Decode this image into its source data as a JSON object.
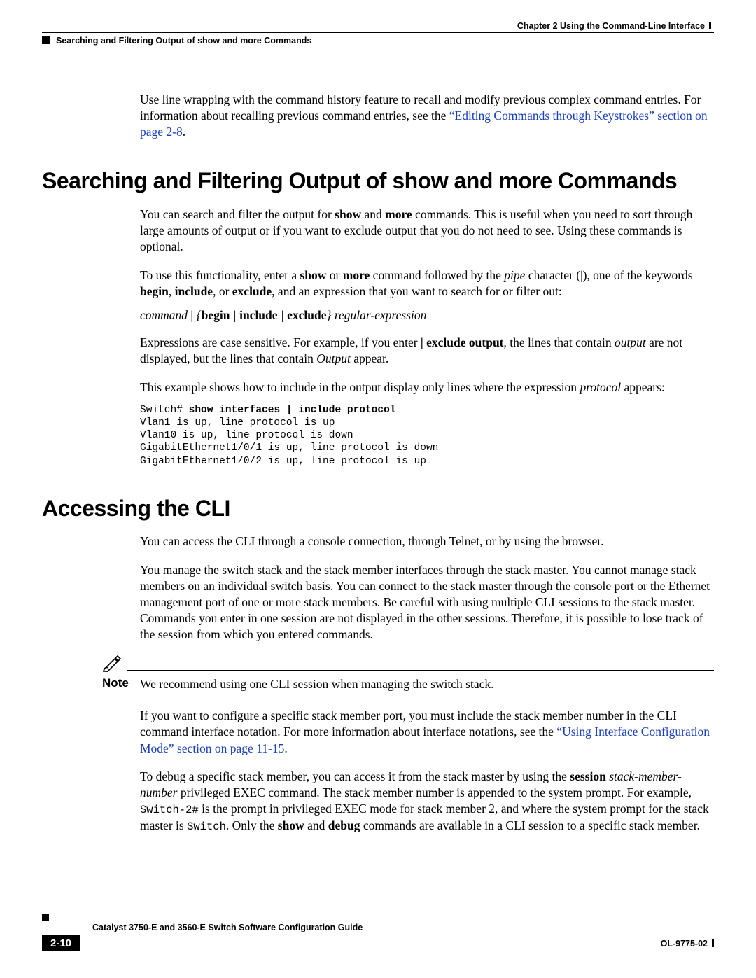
{
  "header": {
    "chapter": "Chapter 2      Using the Command-Line Interface",
    "section": "Searching and Filtering Output of show and more Commands"
  },
  "intro_para_pre": "Use line wrapping with the command history feature to recall and modify previous complex command entries. For information about recalling previous command entries, see the ",
  "intro_link": "“Editing Commands through Keystrokes” section on page 2-8",
  "intro_para_post": ".",
  "s1": {
    "title": "Searching and Filtering Output of show and more Commands",
    "p1_a": "You can search and filter the output for ",
    "p1_b": " and ",
    "p1_c": " commands. This is useful when you need to sort through large amounts of output or if you want to exclude output that you do not need to see. Using these commands is optional.",
    "p2_a": "To use this functionality, enter a ",
    "p2_b": " or ",
    "p2_c": " command followed by the ",
    "p2_d": " character (|), one of the keywords ",
    "p2_e": ", ",
    "p2_f": ", or ",
    "p2_g": ", and an expression that you want to search for or filter out:",
    "syntax_cmd": "command",
    "syntax_begin": "begin",
    "syntax_include": "include",
    "syntax_exclude": "exclude",
    "syntax_regex": "regular-expression",
    "p3_a": "Expressions are case sensitive. For example, if you enter ",
    "p3_b": ", the lines that contain ",
    "p3_c": " are not displayed, but the lines that contain ",
    "p3_d": " appear.",
    "p4_a": "This example shows how to include in the output display only lines where the expression ",
    "p4_b": " appears:",
    "code_prompt": "Switch# ",
    "code_cmd": "show interfaces | include protocol",
    "code_out": "Vlan1 is up, line protocol is up\nVlan10 is up, line protocol is down\nGigabitEthernet1/0/1 is up, line protocol is down\nGigabitEthernet1/0/2 is up, line protocol is up"
  },
  "s2": {
    "title": "Accessing the CLI",
    "p1": "You can access the CLI through a console connection, through Telnet, or by using the browser.",
    "p2": "You manage the switch stack and the stack member interfaces through the stack master. You cannot manage stack members on an individual switch basis. You can connect to the stack master through the console port or the Ethernet management port of one or more stack members. Be careful with using multiple CLI sessions to the stack master. Commands you enter in one session are not displayed in the other sessions. Therefore, it is possible to lose track of the session from which you entered commands.",
    "note_label": "Note",
    "note_text": "We recommend using one CLI session when managing the switch stack.",
    "p3_a": "If you want to configure a specific stack member port, you must include the stack member number in the CLI command interface notation. For more information about interface notations, see the ",
    "p3_link": "“Using Interface Configuration Mode” section on page 11-15",
    "p3_b": ".",
    "p4_a": "To debug a specific stack member, you can access it from the stack master by using the ",
    "p4_b": " ",
    "p4_c": " privileged EXEC command. The stack member number is appended to the system prompt. For example, ",
    "p4_d": " is the prompt in privileged EXEC mode for stack member 2, and where the system prompt for the stack master is ",
    "p4_e": ". Only the ",
    "p4_f": " and ",
    "p4_g": " commands are available in a CLI session to a specific stack member."
  },
  "bold_words": {
    "show": "show",
    "more": "more",
    "begin": "begin",
    "include": "include",
    "exclude": "exclude",
    "exclude_output": "| exclude output",
    "session": "session",
    "debug": "debug"
  },
  "italic_words": {
    "pipe": "pipe",
    "output": "output",
    "Output": "Output",
    "protocol": "protocol",
    "stack_member_number": "stack-member-number"
  },
  "mono_words": {
    "switch2": "Switch-2#",
    "switch": "Switch"
  },
  "footer": {
    "guide": "Catalyst 3750-E and 3560-E Switch Software Configuration Guide",
    "page": "2-10",
    "doc": "OL-9775-02"
  }
}
